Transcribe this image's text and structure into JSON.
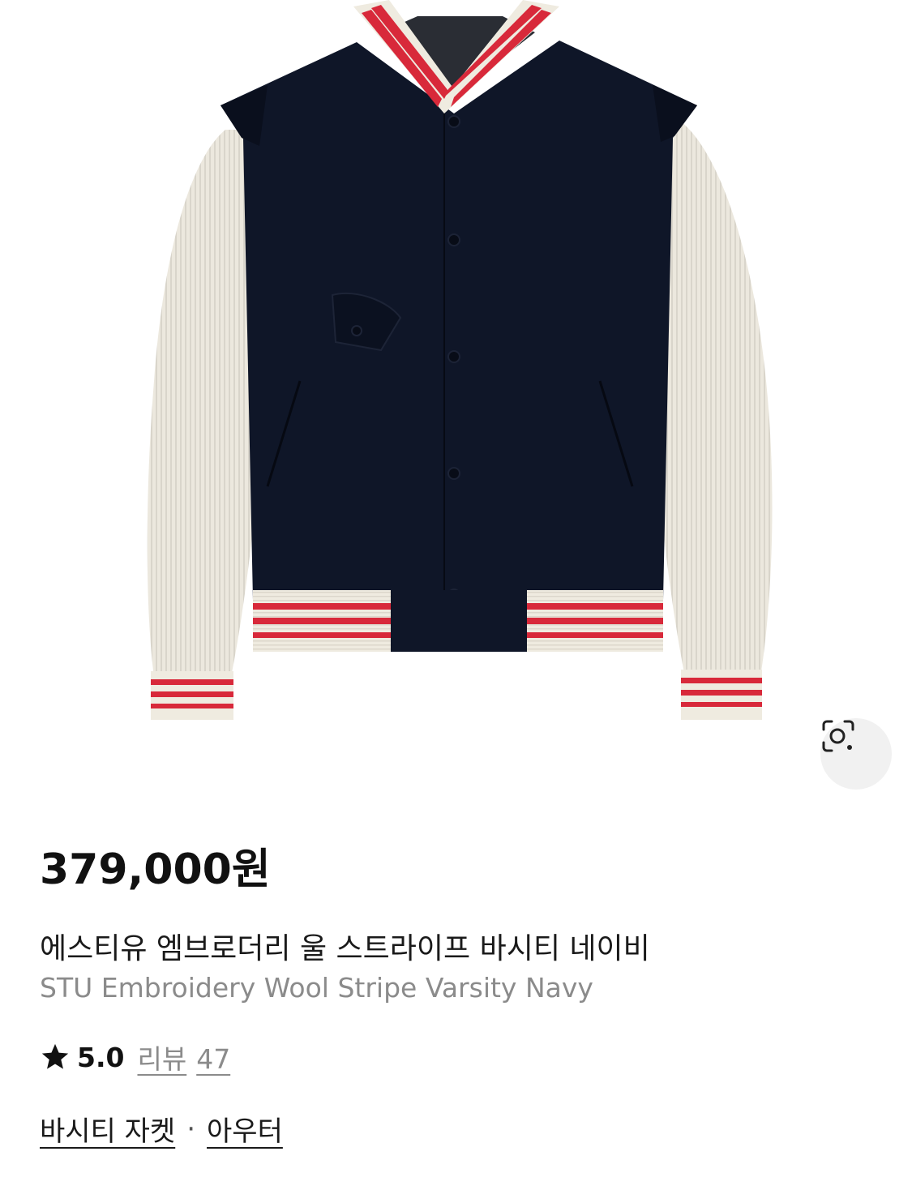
{
  "product": {
    "image_alt": "navy varsity jacket with cream ribbed sleeves and red stripe trim",
    "lens_icon": "image-search-icon",
    "price": "379,000원",
    "name_ko": "에스티유 엠브로더리 울 스트라이프 바시티 네이비",
    "name_en": "STU Embroidery Wool Stripe Varsity Navy",
    "rating": {
      "icon": "star-icon",
      "score": "5.0",
      "review_label": "리뷰",
      "review_count": "47"
    },
    "categories": {
      "primary": "바시티 자켓",
      "separator": "·",
      "secondary": "아우터"
    }
  },
  "colors": {
    "navy": "#0f1628",
    "cream": "#efebe0",
    "stripe_red": "#d8293a",
    "muted_text": "#8b8b8b"
  }
}
